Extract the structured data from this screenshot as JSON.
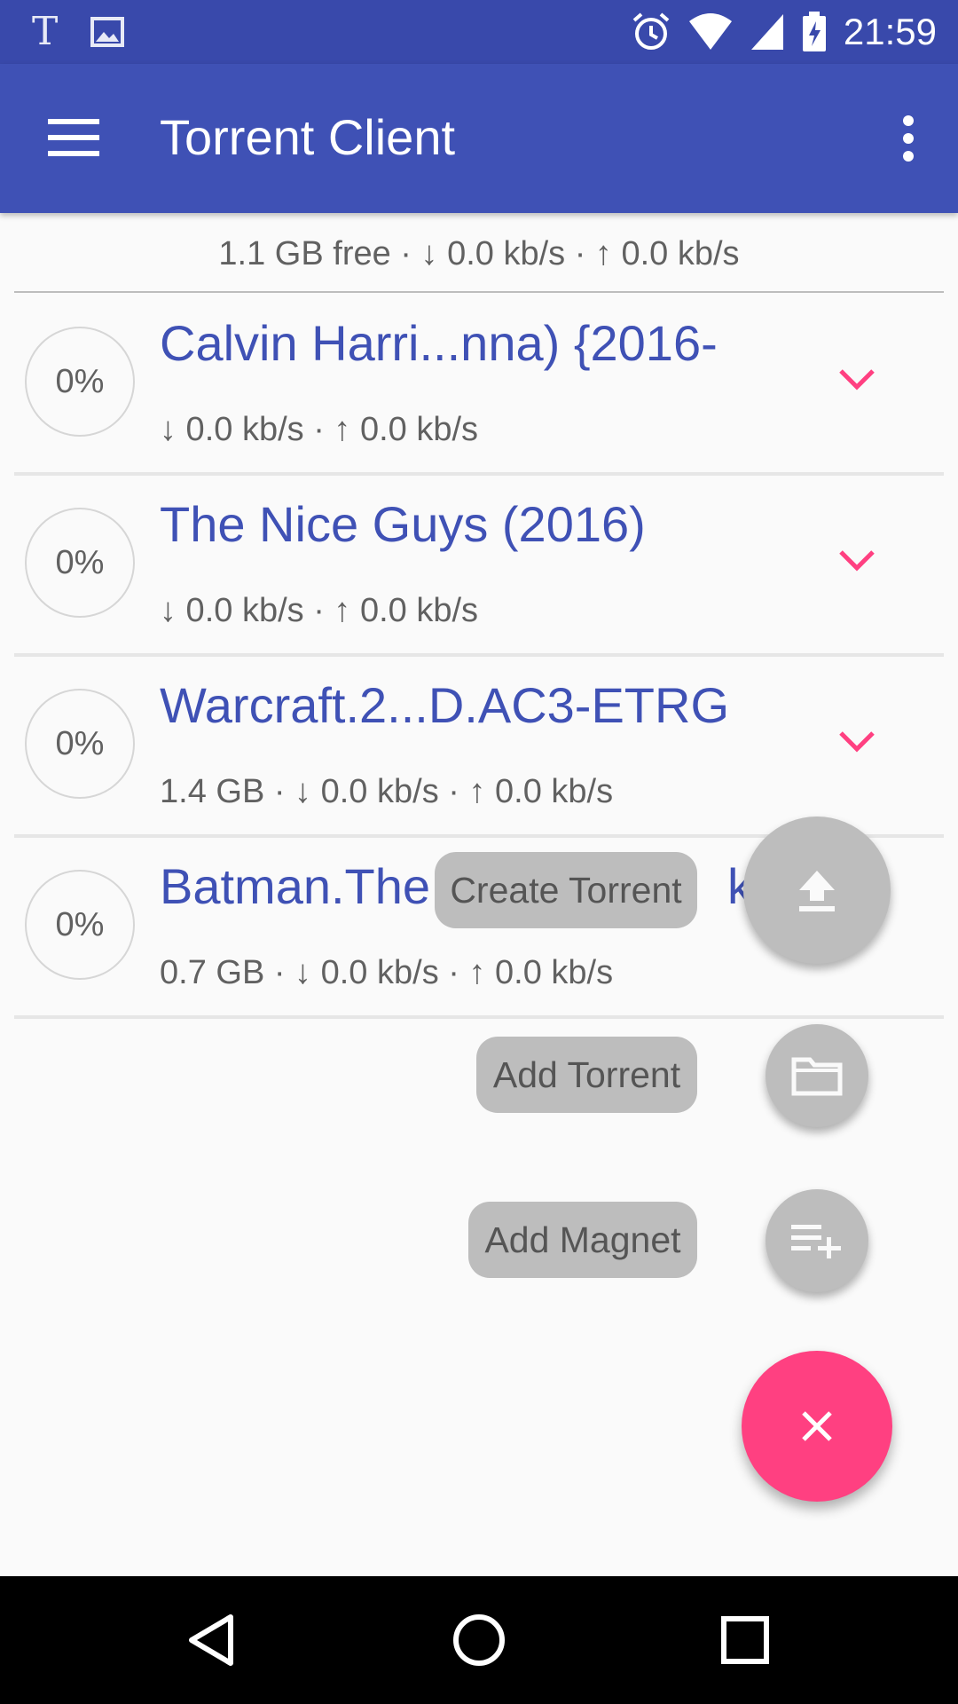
{
  "status_bar": {
    "left_icons": [
      "text-notification-icon",
      "image-notification-icon"
    ],
    "right_icons": [
      "alarm-icon",
      "wifi-icon",
      "cell-signal-icon",
      "battery-charging-icon"
    ],
    "time": "21:59"
  },
  "app_bar": {
    "title": "Torrent Client",
    "menu_icon": "hamburger-menu-icon",
    "overflow_icon": "more-vert-icon"
  },
  "summary": "1.1 GB free · ↓ 0.0 kb/s · ↑ 0.0 kb/s",
  "torrents": [
    {
      "progress": "0%",
      "title": "Calvin Harri...nna) {2016-",
      "stats": "↓ 0.0 kb/s · ↑ 0.0 kb/s",
      "expandable": true
    },
    {
      "progress": "0%",
      "title": "The Nice Guys (2016)",
      "stats": "↓ 0.0 kb/s · ↑ 0.0 kb/s",
      "expandable": true
    },
    {
      "progress": "0%",
      "title": "Warcraft.2...D.AC3-ETRG",
      "stats": "1.4 GB · ↓ 0.0 kb/s · ↑ 0.0 kb/s",
      "expandable": true
    },
    {
      "progress": "0%",
      "title": "Batman.The",
      "title_suffix": "kv",
      "stats": "0.7 GB · ↓ 0.0 kb/s · ↑ 0.0 kb/s",
      "expandable": false
    }
  ],
  "fab_menu": {
    "create_torrent": {
      "label": "Create Torrent",
      "icon": "upload-icon"
    },
    "add_torrent": {
      "label": "Add Torrent",
      "icon": "folder-icon"
    },
    "add_magnet": {
      "label": "Add Magnet",
      "icon": "playlist-add-icon"
    },
    "close": {
      "icon": "close-icon"
    }
  },
  "colors": {
    "status_bar": "#3949ab",
    "app_bar": "#3f51b5",
    "accent": "#ff4081",
    "title_text": "#3f51b5",
    "fab_mini": "#bdbdbd"
  },
  "nav_bar": {
    "buttons": [
      "back-icon",
      "home-icon",
      "recents-icon"
    ]
  }
}
